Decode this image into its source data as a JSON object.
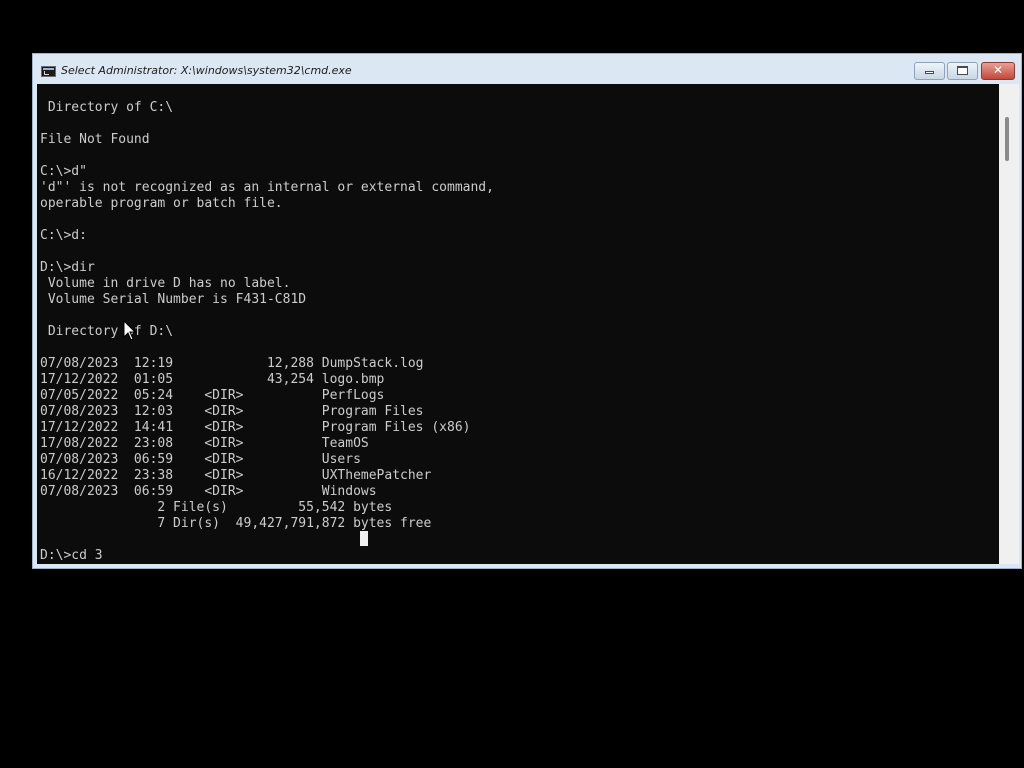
{
  "window": {
    "title": "Select Administrator: X:\\windows\\system32\\cmd.exe",
    "app_icon": "cmd-icon",
    "controls": [
      {
        "name": "minimize",
        "icon": "minimize-icon"
      },
      {
        "name": "maximize",
        "icon": "maximize-icon"
      },
      {
        "name": "close",
        "icon": "close-icon",
        "glyph": "✕"
      }
    ]
  },
  "console": {
    "lines": [
      " Directory of C:\\",
      "",
      "File Not Found",
      "",
      "C:\\>d\"",
      "'d\"' is not recognized as an internal or external command,",
      "operable program or batch file.",
      "",
      "C:\\>d:",
      "",
      "D:\\>dir",
      " Volume in drive D has no label.",
      " Volume Serial Number is F431-C81D",
      "",
      " Directory of D:\\",
      "",
      "07/08/2023  12:19            12,288 DumpStack.log",
      "17/12/2022  01:05            43,254 logo.bmp",
      "07/05/2022  05:24    <DIR>          PerfLogs",
      "07/08/2023  12:03    <DIR>          Program Files",
      "17/12/2022  14:41    <DIR>          Program Files (x86)",
      "17/08/2022  23:08    <DIR>          TeamOS",
      "07/08/2023  06:59    <DIR>          Users",
      "16/12/2022  23:38    <DIR>          UXThemePatcher",
      "07/08/2023  06:59    <DIR>          Windows",
      "               2 File(s)         55,542 bytes",
      "               7 Dir(s)  49,427,791,872 bytes free",
      "",
      "D:\\>cd 3"
    ]
  },
  "colors": {
    "console_bg": "#0c0c0c",
    "console_text": "#cccccc",
    "titlebar_bg": "#dbe7f3",
    "close_button": "#c3473a"
  }
}
